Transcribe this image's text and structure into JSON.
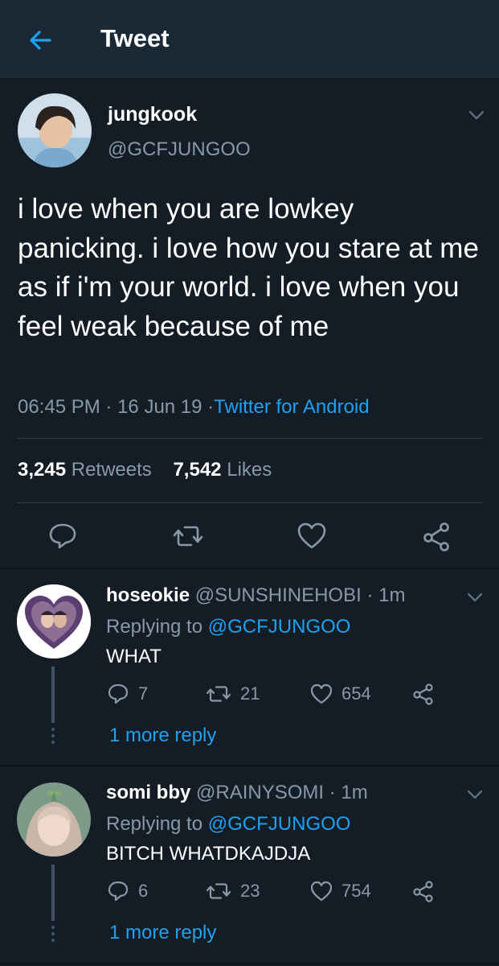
{
  "header": {
    "title": "Tweet"
  },
  "colors": {
    "background": "#141d26",
    "header_bg": "#1b2836",
    "accent": "#1da1f2",
    "secondary_text": "#8899a6"
  },
  "tweet": {
    "name": "jungkook",
    "handle": "@GCFJUNGOO",
    "text": "i love when you are lowkey panicking. i love how you stare at me as if i'm your world. i love when you feel weak because of me",
    "time": "06:45 PM",
    "date": "16 Jun 19",
    "source": "Twitter for Android",
    "sep": "·",
    "retweets_count": "3,245",
    "retweets_label": "Retweets",
    "likes_count": "7,542",
    "likes_label": "Likes",
    "icons": [
      "reply-icon",
      "retweet-icon",
      "heart-icon",
      "share-icon"
    ]
  },
  "replies": [
    {
      "name": "hoseokie",
      "handle": "@SUNSHINEHOBI",
      "time": "· 1m",
      "replying_label": "Replying to",
      "replying_to": "@GCFJUNGOO",
      "text": "WHAT",
      "replies": "7",
      "retweets": "21",
      "likes": "654",
      "more": "1 more reply"
    },
    {
      "name": "somi bby",
      "handle": "@RAINYSOMI",
      "time": "· 1m",
      "replying_label": "Replying to",
      "replying_to": "@GCFJUNGOO",
      "text": "BITCH WHATDKAJDJA",
      "replies": "6",
      "retweets": "23",
      "likes": "754",
      "more": "1 more reply"
    }
  ]
}
